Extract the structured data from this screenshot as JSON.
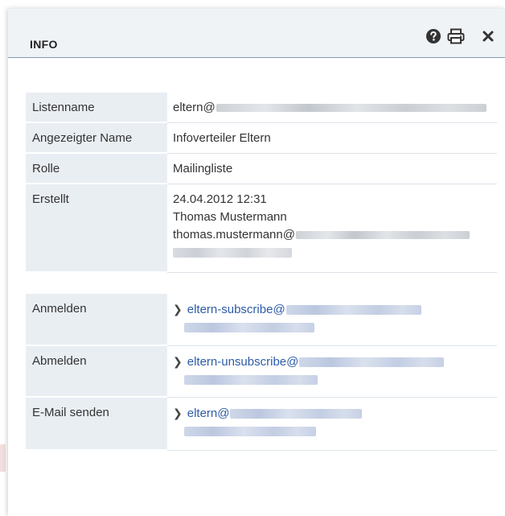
{
  "dialog": {
    "title": "INFO",
    "icons": [
      "help-icon",
      "print-icon",
      "close-icon"
    ]
  },
  "details": [
    {
      "label": "Listenname",
      "value": "eltern@"
    },
    {
      "label": "Angezeigter Name",
      "value": "Infoverteiler Eltern"
    },
    {
      "label": "Rolle",
      "value": "Mailingliste"
    },
    {
      "label": "Erstellt",
      "lines": [
        "24.04.2012 12:31",
        "Thomas Mustermann",
        "thomas.mustermann@"
      ]
    }
  ],
  "actions": [
    {
      "label": "Anmelden",
      "link": "eltern-subscribe@"
    },
    {
      "label": "Abmelden",
      "link": "eltern-unsubscribe@"
    },
    {
      "label": "E-Mail senden",
      "link": "eltern@"
    }
  ],
  "colors": {
    "link": "#2d5ca8",
    "label_bg": "#e9eef3",
    "header_bg": "#f0f3f6"
  }
}
